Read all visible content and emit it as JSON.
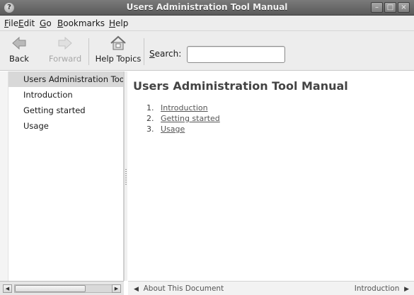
{
  "window": {
    "title": "Users Administration Tool Manual",
    "app_icon": "help-icon",
    "controls": [
      "minimize-icon",
      "maximize-icon",
      "close-icon"
    ]
  },
  "menubar": {
    "items": [
      {
        "pre": "",
        "mn": "F",
        "post": "ile"
      },
      {
        "pre": "",
        "mn": "E",
        "post": "dit"
      },
      {
        "pre": "",
        "mn": "G",
        "post": "o"
      },
      {
        "pre": "",
        "mn": "B",
        "post": "ookmarks"
      },
      {
        "pre": "",
        "mn": "H",
        "post": "elp"
      }
    ]
  },
  "toolbar": {
    "back_label": "Back",
    "forward_label": "Forward",
    "help_topics_label": "Help Topics",
    "search_label_pre": "",
    "search_label_mn": "S",
    "search_label_post": "earch:",
    "search_value": ""
  },
  "sidebar": {
    "items": [
      {
        "label": "Users Administration Tool Manual",
        "selected": true
      },
      {
        "label": "Introduction",
        "selected": false
      },
      {
        "label": "Getting started",
        "selected": false
      },
      {
        "label": "Usage",
        "selected": false
      }
    ]
  },
  "main": {
    "heading": "Users Administration Tool Manual",
    "toc": [
      {
        "num": "1.",
        "label": "Introduction"
      },
      {
        "num": "2.",
        "label": "Getting started"
      },
      {
        "num": "3.",
        "label": "Usage"
      }
    ]
  },
  "footer": {
    "prev_label": "About This Document",
    "next_label": "Introduction",
    "prev_arrow": "◀",
    "next_arrow": "▶"
  }
}
